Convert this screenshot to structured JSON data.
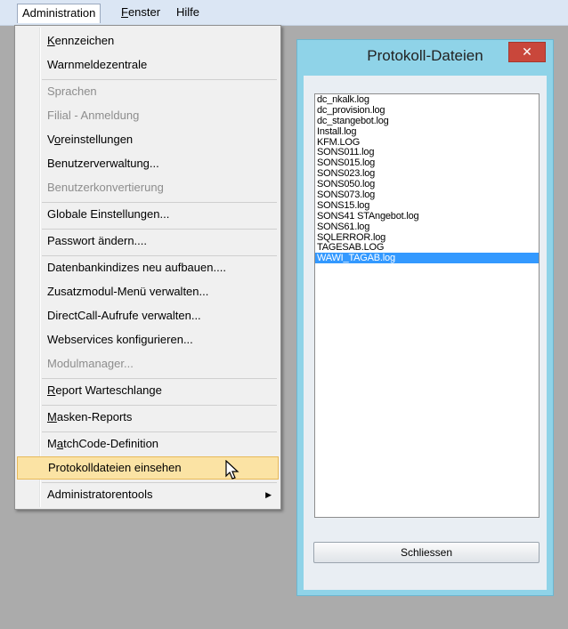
{
  "menubar": {
    "items": [
      {
        "label": "Administration",
        "mnemonic": "",
        "rest": ""
      },
      {
        "label": "",
        "mnemonic": "F",
        "rest": "enster"
      },
      {
        "label": "Hilfe",
        "mnemonic": "",
        "rest": ""
      }
    ]
  },
  "menu": {
    "items": [
      {
        "mn": "K",
        "rest": "ennzeichen"
      },
      {
        "label": "Warnmeldezentrale"
      },
      {
        "label": "Sprachen"
      },
      {
        "label": "Filial - Anmeldung"
      },
      {
        "pre": "V",
        "mn": "o",
        "rest": "reinstellungen"
      },
      {
        "label": "Benutzerverwaltung..."
      },
      {
        "label": "Benutzerkonvertierung"
      },
      {
        "label": "Globale Einstellungen..."
      },
      {
        "label": "Passwort ändern...."
      },
      {
        "label": "Datenbankindizes neu aufbauen...."
      },
      {
        "label": "Zusatzmodul-Menü verwalten..."
      },
      {
        "label": "DirectCall-Aufrufe verwalten..."
      },
      {
        "label": "Webservices konfigurieren..."
      },
      {
        "label": "Modulmanager..."
      },
      {
        "mn": "R",
        "rest": "eport Warteschlange"
      },
      {
        "mn": "M",
        "rest": "asken-Reports"
      },
      {
        "pre": "M",
        "mn": "a",
        "rest": "tchCode-Definition"
      },
      {
        "label": "Protokolldateien einsehen"
      },
      {
        "label": "Administratorentools",
        "arrow": "▶"
      }
    ]
  },
  "dialog": {
    "title": "Protokoll-Dateien",
    "close": "✕",
    "files": [
      "dc_nkalk.log",
      "dc_provision.log",
      "dc_stangebot.log",
      "Install.log",
      "KFM.LOG",
      "SONS011.log",
      "SONS015.log",
      "SONS023.log",
      "SONS050.log",
      "SONS073.log",
      "SONS15.log",
      "SONS41 STAngebot.log",
      "SONS61.log",
      "SQLERROR.log",
      "TAGESAB.LOG",
      "WAWI_TAGAB.log"
    ],
    "selected_file": "WAWI_TAGAB.log",
    "button": "Schliessen"
  },
  "colors": {
    "dialog_frame": "#8fd3e8",
    "highlight": "#fbe3a4",
    "selection": "#3399ff",
    "close_button": "#c9473b"
  }
}
